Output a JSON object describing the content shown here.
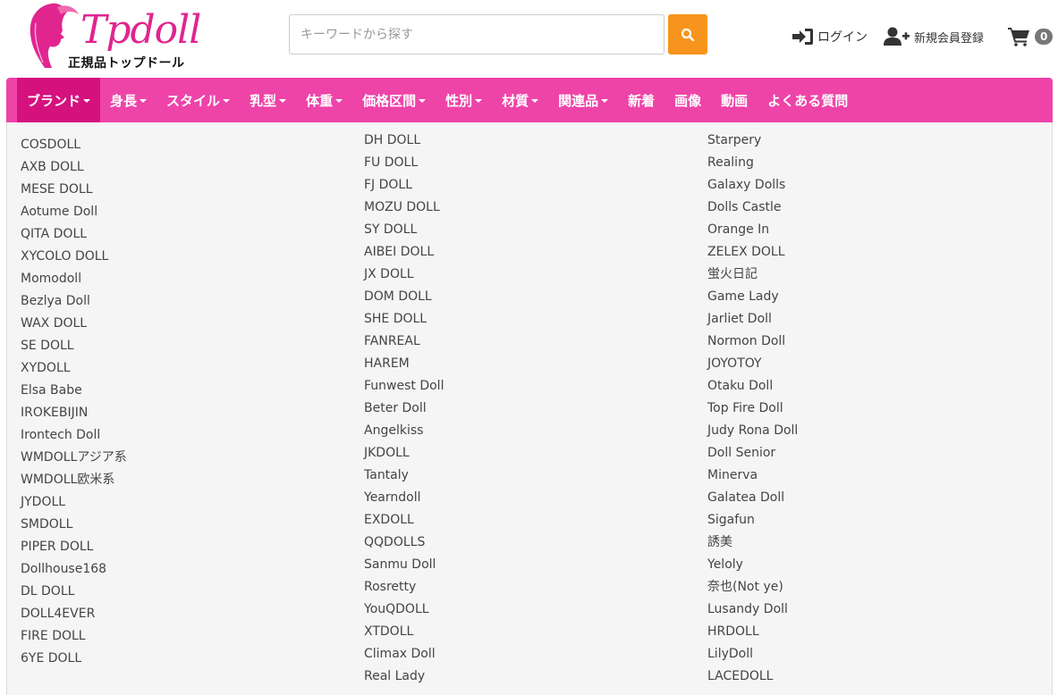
{
  "logo": {
    "text": "Tpdoll",
    "subtitle": "正規品トップドール"
  },
  "search": {
    "placeholder": "キーワードから探す"
  },
  "header": {
    "login_label": "ログイン",
    "register_label": "新規会員登録",
    "cart_count": "0"
  },
  "colors": {
    "brand_pink": "#ee44a8",
    "active_pink": "#d5117e",
    "search_orange": "#f7941d"
  },
  "nav": {
    "items": [
      {
        "label": "ブランド",
        "dropdown": true,
        "active": true
      },
      {
        "label": "身長",
        "dropdown": true
      },
      {
        "label": "スタイル",
        "dropdown": true
      },
      {
        "label": "乳型",
        "dropdown": true
      },
      {
        "label": "体重",
        "dropdown": true
      },
      {
        "label": "価格区間",
        "dropdown": true
      },
      {
        "label": "性別",
        "dropdown": true
      },
      {
        "label": "材質",
        "dropdown": true
      },
      {
        "label": "関連品",
        "dropdown": true
      },
      {
        "label": "新着",
        "dropdown": false
      },
      {
        "label": "画像",
        "dropdown": false
      },
      {
        "label": "動画",
        "dropdown": false
      },
      {
        "label": "よくある質問",
        "dropdown": false
      }
    ]
  },
  "brands": {
    "col1": [
      "COSDOLL",
      "AXB DOLL",
      "MESE DOLL",
      "Aotume Doll",
      "QITA DOLL",
      "XYCOLO DOLL",
      "Momodoll",
      "Bezlya Doll",
      "WAX DOLL",
      "SE DOLL",
      "XYDOLL",
      "Elsa Babe",
      "IROKEBIJIN",
      "Irontech Doll",
      "WMDOLLアジア系",
      "WMDOLL欧米系",
      "JYDOLL",
      "SMDOLL",
      "PIPER DOLL",
      "Dollhouse168",
      "DL DOLL",
      "DOLL4EVER",
      "FIRE DOLL",
      "6YE DOLL"
    ],
    "col2": [
      "DH DOLL",
      "FU DOLL",
      "FJ DOLL",
      "MOZU DOLL",
      "SY DOLL",
      "AIBEI DOLL",
      "JX DOLL",
      "DOM DOLL",
      "SHE DOLL",
      "FANREAL",
      "HAREM",
      "Funwest Doll",
      "Beter Doll",
      "Angelkiss",
      "JKDOLL",
      "Tantaly",
      "Yearndoll",
      "EXDOLL",
      "QQDOLLS",
      "Sanmu Doll",
      "Rosretty",
      "YouQDOLL",
      "XTDOLL",
      "Climax Doll",
      "Real Lady"
    ],
    "col3": [
      "Starpery",
      "Realing",
      "Galaxy Dolls",
      "Dolls Castle",
      "Orange In",
      "ZELEX DOLL",
      "蛍火日記",
      "Game Lady",
      "Jarliet Doll",
      "Normon Doll",
      "JOYOTOY",
      "Otaku Doll",
      "Top Fire Doll",
      "Judy Rona Doll",
      "Doll Senior",
      "Minerva",
      "Galatea Doll",
      "Sigafun",
      "誘美",
      "Yeloly",
      "奈也(Not ye)",
      "Lusandy Doll",
      "HRDOLL",
      "LilyDoll",
      "LACEDOLL"
    ]
  }
}
